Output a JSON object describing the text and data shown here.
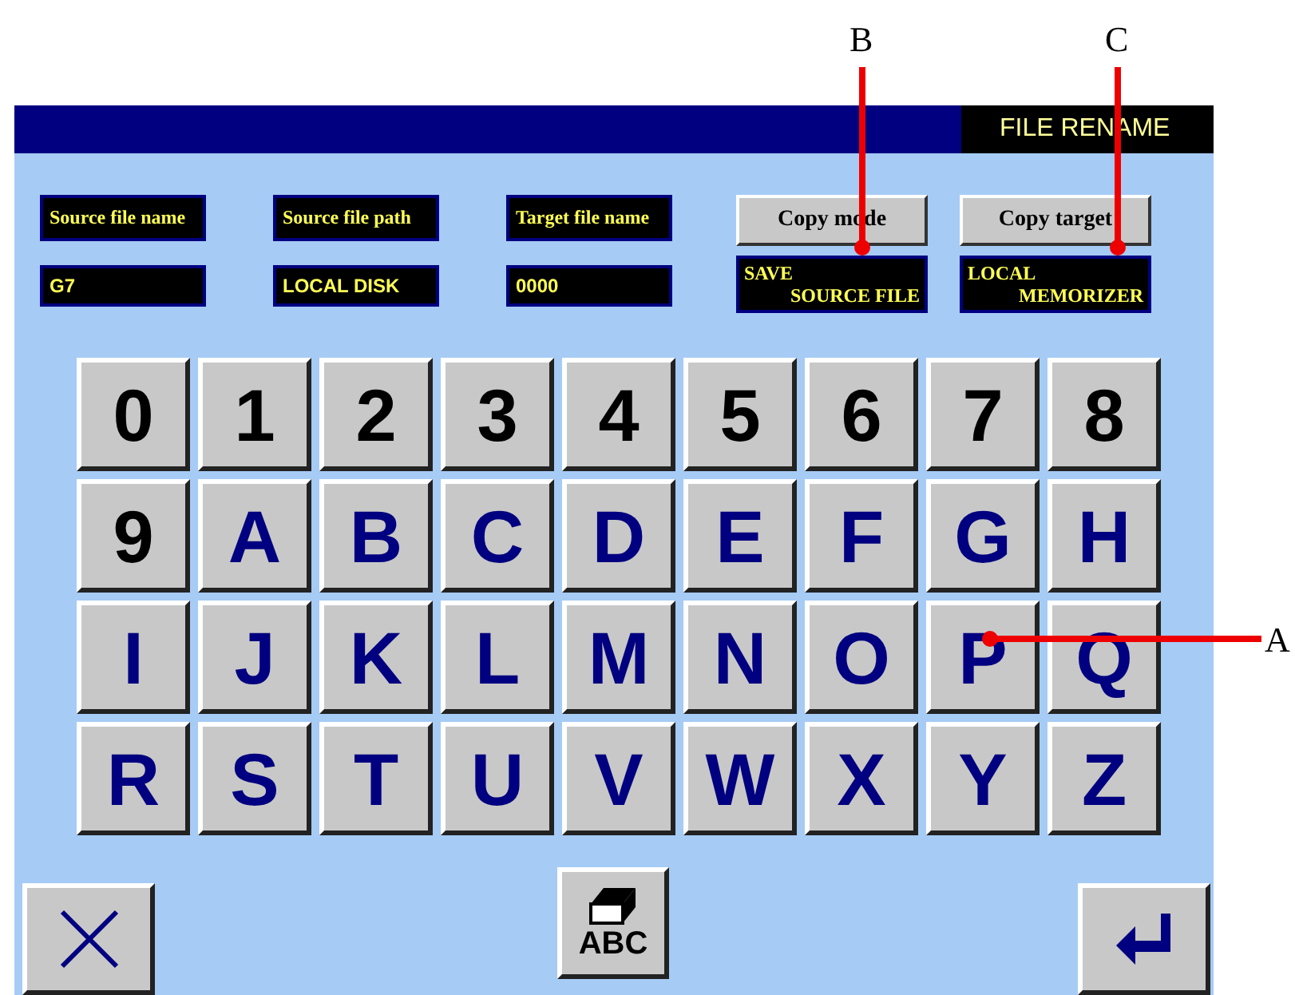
{
  "window": {
    "title": "FILE RENAME"
  },
  "fields": [
    {
      "label": "Source file name",
      "value": "G7"
    },
    {
      "label": "Source file path",
      "value": "LOCAL DISK"
    },
    {
      "label": "Target file name",
      "value": "0000"
    }
  ],
  "mode_buttons": [
    {
      "label": "Copy mode",
      "value_lines": [
        "SAVE",
        "SOURCE FILE"
      ]
    },
    {
      "label": "Copy target",
      "value_lines": [
        "LOCAL",
        "MEMORIZER"
      ]
    }
  ],
  "keys": [
    {
      "label": "0",
      "kind": "digit"
    },
    {
      "label": "1",
      "kind": "digit"
    },
    {
      "label": "2",
      "kind": "digit"
    },
    {
      "label": "3",
      "kind": "digit"
    },
    {
      "label": "4",
      "kind": "digit"
    },
    {
      "label": "5",
      "kind": "digit"
    },
    {
      "label": "6",
      "kind": "digit"
    },
    {
      "label": "7",
      "kind": "digit"
    },
    {
      "label": "8",
      "kind": "digit"
    },
    {
      "label": "9",
      "kind": "digit"
    },
    {
      "label": "A",
      "kind": "letter"
    },
    {
      "label": "B",
      "kind": "letter"
    },
    {
      "label": "C",
      "kind": "letter"
    },
    {
      "label": "D",
      "kind": "letter"
    },
    {
      "label": "E",
      "kind": "letter"
    },
    {
      "label": "F",
      "kind": "letter"
    },
    {
      "label": "G",
      "kind": "letter"
    },
    {
      "label": "H",
      "kind": "letter"
    },
    {
      "label": "I",
      "kind": "letter"
    },
    {
      "label": "J",
      "kind": "letter"
    },
    {
      "label": "K",
      "kind": "letter"
    },
    {
      "label": "L",
      "kind": "letter"
    },
    {
      "label": "M",
      "kind": "letter"
    },
    {
      "label": "N",
      "kind": "letter"
    },
    {
      "label": "O",
      "kind": "letter"
    },
    {
      "label": "P",
      "kind": "letter"
    },
    {
      "label": "Q",
      "kind": "letter"
    },
    {
      "label": "R",
      "kind": "letter"
    },
    {
      "label": "S",
      "kind": "letter"
    },
    {
      "label": "T",
      "kind": "letter"
    },
    {
      "label": "U",
      "kind": "letter"
    },
    {
      "label": "V",
      "kind": "letter"
    },
    {
      "label": "W",
      "kind": "letter"
    },
    {
      "label": "X",
      "kind": "letter"
    },
    {
      "label": "Y",
      "kind": "letter"
    },
    {
      "label": "Z",
      "kind": "letter"
    }
  ],
  "clear_button": {
    "label": "ABC"
  },
  "callouts": [
    {
      "label": "B"
    },
    {
      "label": "C"
    },
    {
      "label": "A"
    }
  ]
}
